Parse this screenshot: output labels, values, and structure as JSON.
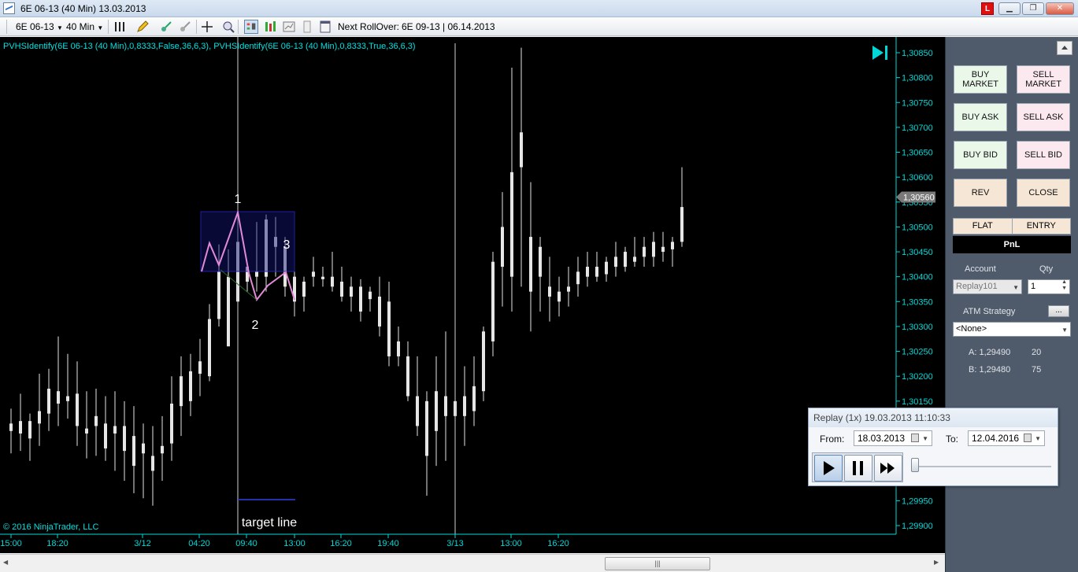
{
  "window": {
    "title": "6E 06-13 (40 Min)  13.03.2013",
    "lbadge": "L",
    "minimize": "▁",
    "restore": "❐",
    "close": "✕"
  },
  "toolbar": {
    "instrument": "6E 06-13",
    "interval": "40 Min",
    "rollover_label": "Next RollOver:",
    "rollover_value": "6E 09-13 | 06.14.2013"
  },
  "chart": {
    "indicator_text": "PVHSIdentify(6E 06-13 (40 Min),0,8333,False,36,6,3),  PVHSIdentify(6E 06-13 (40 Min),0,8333,True,36,6,3)",
    "copyright": "© 2016 NinjaTrader, LLC",
    "annotations": {
      "p1": "1",
      "p2": "2",
      "p3": "3",
      "target": "target line"
    },
    "colors": {
      "background": "#000000",
      "axis": "#00d8d8",
      "candle": "#e6e6e6",
      "pattern": "#e08ad8",
      "box": "#2020a0",
      "price_badge": "#7a7a7a"
    }
  },
  "chart_data": {
    "type": "candlestick",
    "y_ticks": [
      "1,30850",
      "1,30800",
      "1,30750",
      "1,30700",
      "1,30650",
      "1,30600",
      "1,30550",
      "1,30500",
      "1,30450",
      "1,30400",
      "1,30350",
      "1,30300",
      "1,30250",
      "1,30200",
      "1,30150",
      "1,29950",
      "1,29900"
    ],
    "last_price_label": "1,30560",
    "x_ticks": [
      "15:00",
      "18:20",
      "3/12",
      "04:20",
      "09:40",
      "13:00",
      "16:20",
      "19:40",
      "3/13",
      "13:00",
      "16:20"
    ],
    "ylim": [
      1.2988,
      1.3087
    ],
    "candles": [
      {
        "o": 1.30105,
        "h": 1.30135,
        "l": 1.30045,
        "c": 1.3009
      },
      {
        "o": 1.30085,
        "h": 1.30165,
        "l": 1.3005,
        "c": 1.3011
      },
      {
        "o": 1.30075,
        "h": 1.30125,
        "l": 1.3003,
        "c": 1.3011
      },
      {
        "o": 1.30105,
        "h": 1.30205,
        "l": 1.3006,
        "c": 1.3013
      },
      {
        "o": 1.30125,
        "h": 1.30215,
        "l": 1.3009,
        "c": 1.30175
      },
      {
        "o": 1.3017,
        "h": 1.3028,
        "l": 1.301,
        "c": 1.30145
      },
      {
        "o": 1.3015,
        "h": 1.30245,
        "l": 1.30115,
        "c": 1.3016
      },
      {
        "o": 1.30165,
        "h": 1.3023,
        "l": 1.3006,
        "c": 1.301
      },
      {
        "o": 1.30085,
        "h": 1.3017,
        "l": 1.30035,
        "c": 1.30095
      },
      {
        "o": 1.301,
        "h": 1.30175,
        "l": 1.3004,
        "c": 1.3012
      },
      {
        "o": 1.30105,
        "h": 1.3016,
        "l": 1.3003,
        "c": 1.30055
      },
      {
        "o": 1.30085,
        "h": 1.3017,
        "l": 1.3001,
        "c": 1.301
      },
      {
        "o": 1.301,
        "h": 1.3015,
        "l": 1.2999,
        "c": 1.3005
      },
      {
        "o": 1.3008,
        "h": 1.3014,
        "l": 1.29965,
        "c": 1.3002
      },
      {
        "o": 1.30065,
        "h": 1.30105,
        "l": 1.29955,
        "c": 1.30045
      },
      {
        "o": 1.3004,
        "h": 1.301,
        "l": 1.2994,
        "c": 1.3001
      },
      {
        "o": 1.30045,
        "h": 1.3012,
        "l": 1.2999,
        "c": 1.3006
      },
      {
        "o": 1.30065,
        "h": 1.302,
        "l": 1.3003,
        "c": 1.30145
      },
      {
        "o": 1.3014,
        "h": 1.3024,
        "l": 1.3008,
        "c": 1.302
      },
      {
        "o": 1.3015,
        "h": 1.30245,
        "l": 1.3012,
        "c": 1.3021
      },
      {
        "o": 1.30205,
        "h": 1.30275,
        "l": 1.3016,
        "c": 1.3023
      },
      {
        "o": 1.302,
        "h": 1.30345,
        "l": 1.3019,
        "c": 1.30315
      },
      {
        "o": 1.30315,
        "h": 1.30465,
        "l": 1.303,
        "c": 1.3041
      },
      {
        "o": 1.304,
        "h": 1.30455,
        "l": 1.3035,
        "c": 1.3026
      },
      {
        "o": 1.3035,
        "h": 1.3046,
        "l": 1.3032,
        "c": 1.3047
      },
      {
        "o": 1.3039,
        "h": 1.30425,
        "l": 1.3037,
        "c": 1.3042
      },
      {
        "o": 1.304,
        "h": 1.3051,
        "l": 1.3037,
        "c": 1.3041
      },
      {
        "o": 1.304,
        "h": 1.30525,
        "l": 1.3037,
        "c": 1.30515
      },
      {
        "o": 1.3048,
        "h": 1.3052,
        "l": 1.304,
        "c": 1.3046
      },
      {
        "o": 1.3046,
        "h": 1.3048,
        "l": 1.3036,
        "c": 1.3038
      },
      {
        "o": 1.304,
        "h": 1.3044,
        "l": 1.3032,
        "c": 1.3035
      },
      {
        "o": 1.3036,
        "h": 1.304,
        "l": 1.3033,
        "c": 1.3039
      },
      {
        "o": 1.304,
        "h": 1.3044,
        "l": 1.3038,
        "c": 1.3041
      },
      {
        "o": 1.304,
        "h": 1.3042,
        "l": 1.3038,
        "c": 1.30395
      },
      {
        "o": 1.304,
        "h": 1.3045,
        "l": 1.3037,
        "c": 1.3038
      },
      {
        "o": 1.3039,
        "h": 1.3042,
        "l": 1.3035,
        "c": 1.3036
      },
      {
        "o": 1.3038,
        "h": 1.304,
        "l": 1.3033,
        "c": 1.3036
      },
      {
        "o": 1.3038,
        "h": 1.30395,
        "l": 1.3031,
        "c": 1.3033
      },
      {
        "o": 1.3037,
        "h": 1.3038,
        "l": 1.3033,
        "c": 1.30355
      },
      {
        "o": 1.3036,
        "h": 1.304,
        "l": 1.3028,
        "c": 1.303
      },
      {
        "o": 1.3035,
        "h": 1.3039,
        "l": 1.3022,
        "c": 1.3024
      },
      {
        "o": 1.3027,
        "h": 1.303,
        "l": 1.3022,
        "c": 1.3024
      },
      {
        "o": 1.3024,
        "h": 1.3027,
        "l": 1.3015,
        "c": 1.3016
      },
      {
        "o": 1.3016,
        "h": 1.3024,
        "l": 1.3008,
        "c": 1.301
      },
      {
        "o": 1.3015,
        "h": 1.3017,
        "l": 1.2996,
        "c": 1.3004
      },
      {
        "o": 1.3009,
        "h": 1.3024,
        "l": 1.3002,
        "c": 1.3017
      },
      {
        "o": 1.3016,
        "h": 1.3029,
        "l": 1.3003,
        "c": 1.3012
      },
      {
        "o": 1.3015,
        "h": 1.3023,
        "l": 1.3006,
        "c": 1.3012
      },
      {
        "o": 1.3012,
        "h": 1.3022,
        "l": 1.3006,
        "c": 1.3016
      },
      {
        "o": 1.3013,
        "h": 1.3024,
        "l": 1.301,
        "c": 1.3018
      },
      {
        "o": 1.3017,
        "h": 1.303,
        "l": 1.3015,
        "c": 1.3029
      },
      {
        "o": 1.3027,
        "h": 1.3045,
        "l": 1.3024,
        "c": 1.3043
      },
      {
        "o": 1.3042,
        "h": 1.3057,
        "l": 1.3034,
        "c": 1.305
      },
      {
        "o": 1.304,
        "h": 1.3082,
        "l": 1.3033,
        "c": 1.3061
      },
      {
        "o": 1.3062,
        "h": 1.3086,
        "l": 1.3038,
        "c": 1.3069
      },
      {
        "o": 1.3048,
        "h": 1.3059,
        "l": 1.3029,
        "c": 1.3037
      },
      {
        "o": 1.304,
        "h": 1.3048,
        "l": 1.3033,
        "c": 1.3046
      },
      {
        "o": 1.3038,
        "h": 1.3044,
        "l": 1.3031,
        "c": 1.3036
      },
      {
        "o": 1.3037,
        "h": 1.304,
        "l": 1.3032,
        "c": 1.3035
      },
      {
        "o": 1.3037,
        "h": 1.3042,
        "l": 1.3034,
        "c": 1.3038
      },
      {
        "o": 1.30385,
        "h": 1.3044,
        "l": 1.3036,
        "c": 1.3041
      },
      {
        "o": 1.304,
        "h": 1.3045,
        "l": 1.3038,
        "c": 1.3042
      },
      {
        "o": 1.3042,
        "h": 1.3045,
        "l": 1.3039,
        "c": 1.304
      },
      {
        "o": 1.30405,
        "h": 1.3044,
        "l": 1.3039,
        "c": 1.3043
      },
      {
        "o": 1.3042,
        "h": 1.3047,
        "l": 1.304,
        "c": 1.3044
      },
      {
        "o": 1.3042,
        "h": 1.3046,
        "l": 1.3041,
        "c": 1.3045
      },
      {
        "o": 1.3043,
        "h": 1.3048,
        "l": 1.3042,
        "c": 1.3044
      },
      {
        "o": 1.3044,
        "h": 1.3048,
        "l": 1.3042,
        "c": 1.3046
      },
      {
        "o": 1.3044,
        "h": 1.3049,
        "l": 1.3042,
        "c": 1.3047
      },
      {
        "o": 1.3046,
        "h": 1.3049,
        "l": 1.3043,
        "c": 1.3045
      },
      {
        "o": 1.30455,
        "h": 1.3048,
        "l": 1.3042,
        "c": 1.3047
      },
      {
        "o": 1.3047,
        "h": 1.3062,
        "l": 1.3046,
        "c": 1.3054
      }
    ]
  },
  "panel": {
    "buy_market": "BUY MARKET",
    "sell_market": "SELL MARKET",
    "buy_ask": "BUY ASK",
    "sell_ask": "SELL ASK",
    "buy_bid": "BUY BID",
    "sell_bid": "SELL BID",
    "rev": "REV",
    "close": "CLOSE",
    "flat": "FLAT",
    "entry": "ENTRY",
    "pnl": "PnL",
    "account_label": "Account",
    "account_value": "Replay101",
    "qty_label": "Qty",
    "qty_value": "1",
    "atm_label": "ATM Strategy",
    "atm_button": "...",
    "atm_value": "<None>",
    "ask_label": "A: 1,29490",
    "ask_size": "20",
    "bid_label": "B: 1,29480",
    "bid_size": "75"
  },
  "replay": {
    "title": "Replay (1x) 19.03.2013 11:10:33",
    "from_label": "From:",
    "from_value": "18.03.2013",
    "to_label": "To:",
    "to_value": "12.04.2016"
  }
}
